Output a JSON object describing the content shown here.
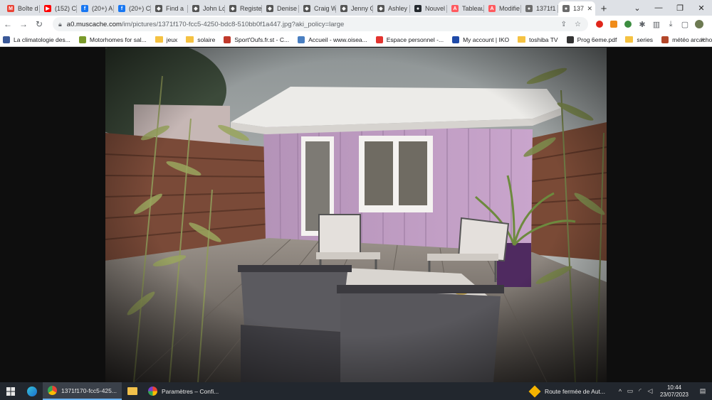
{
  "browser": {
    "tabs": [
      {
        "label": "Boîte d",
        "icon": "gmail-icon",
        "color": "#ea4335",
        "glyph": "M"
      },
      {
        "label": "(152) C",
        "icon": "youtube-icon",
        "color": "#ff0000",
        "glyph": "▶"
      },
      {
        "label": "(20+) A",
        "icon": "facebook-icon",
        "color": "#1877f2",
        "glyph": "f"
      },
      {
        "label": "(20+) C",
        "icon": "facebook-icon",
        "color": "#1877f2",
        "glyph": "f"
      },
      {
        "label": "Find a",
        "icon": "site-icon",
        "color": "#555555",
        "glyph": "◆"
      },
      {
        "label": "John Lo",
        "icon": "site-icon",
        "color": "#555555",
        "glyph": "◆"
      },
      {
        "label": "Registe",
        "icon": "site-icon",
        "color": "#555555",
        "glyph": "◆"
      },
      {
        "label": "Denise",
        "icon": "site-icon",
        "color": "#555555",
        "glyph": "◆"
      },
      {
        "label": "Craig W",
        "icon": "site-icon",
        "color": "#555555",
        "glyph": "◆"
      },
      {
        "label": "Jenny C",
        "icon": "site-icon",
        "color": "#555555",
        "glyph": "◆"
      },
      {
        "label": "Ashley",
        "icon": "site-icon",
        "color": "#555555",
        "glyph": "◆"
      },
      {
        "label": "Nouvel",
        "icon": "github-icon",
        "color": "#24292e",
        "glyph": "●"
      },
      {
        "label": "Tableau",
        "icon": "airbnb-icon",
        "color": "#ff5a5f",
        "glyph": "A"
      },
      {
        "label": "Modifie",
        "icon": "airbnb-icon",
        "color": "#ff5a5f",
        "glyph": "A"
      },
      {
        "label": "1371f1",
        "icon": "globe-icon",
        "color": "#6b6b6b",
        "glyph": "●"
      },
      {
        "label": "137",
        "icon": "globe-icon",
        "color": "#6b6b6b",
        "glyph": "●",
        "active": true
      }
    ],
    "new_tab_label": "+",
    "url": {
      "host": "a0.muscache.com",
      "path": "/im/pictures/1371f170-fcc5-4250-bdc8-510bb0f1a447.jpg?aki_policy=large"
    },
    "bookmarks": [
      {
        "label": "La climatologie des...",
        "type": "site",
        "color": "#3b5998"
      },
      {
        "label": "Motorhomes for sal...",
        "type": "site",
        "color": "#7a9a2a"
      },
      {
        "label": "jeux",
        "type": "folder"
      },
      {
        "label": "solaire",
        "type": "folder"
      },
      {
        "label": "Sport'Oufs.fr.st - C...",
        "type": "site",
        "color": "#c0392b"
      },
      {
        "label": "Accueil - www.oisea...",
        "type": "site",
        "color": "#4a7fc1"
      },
      {
        "label": "Espace personnel -...",
        "type": "site",
        "color": "#e3342f"
      },
      {
        "label": "My account | IKO",
        "type": "site",
        "color": "#1f4aa8"
      },
      {
        "label": "toshiba TV",
        "type": "folder"
      },
      {
        "label": "Prog 6eme.pdf",
        "type": "site",
        "color": "#333333"
      },
      {
        "label": "series",
        "type": "folder"
      },
      {
        "label": "météo arcachon, ve...",
        "type": "site",
        "color": "#b3472a"
      }
    ],
    "bookmarks_more": "»"
  },
  "taskbar": {
    "apps": [
      {
        "label": "1371f170-fcc5-425...",
        "icon": "chrome-icon",
        "active": true
      },
      {
        "label": "Paramètres – Confi...",
        "icon": "settings-app-icon",
        "active": false
      }
    ],
    "notification": "Route fermée de Aut...",
    "time": "10:44",
    "date": "23/07/2023"
  }
}
